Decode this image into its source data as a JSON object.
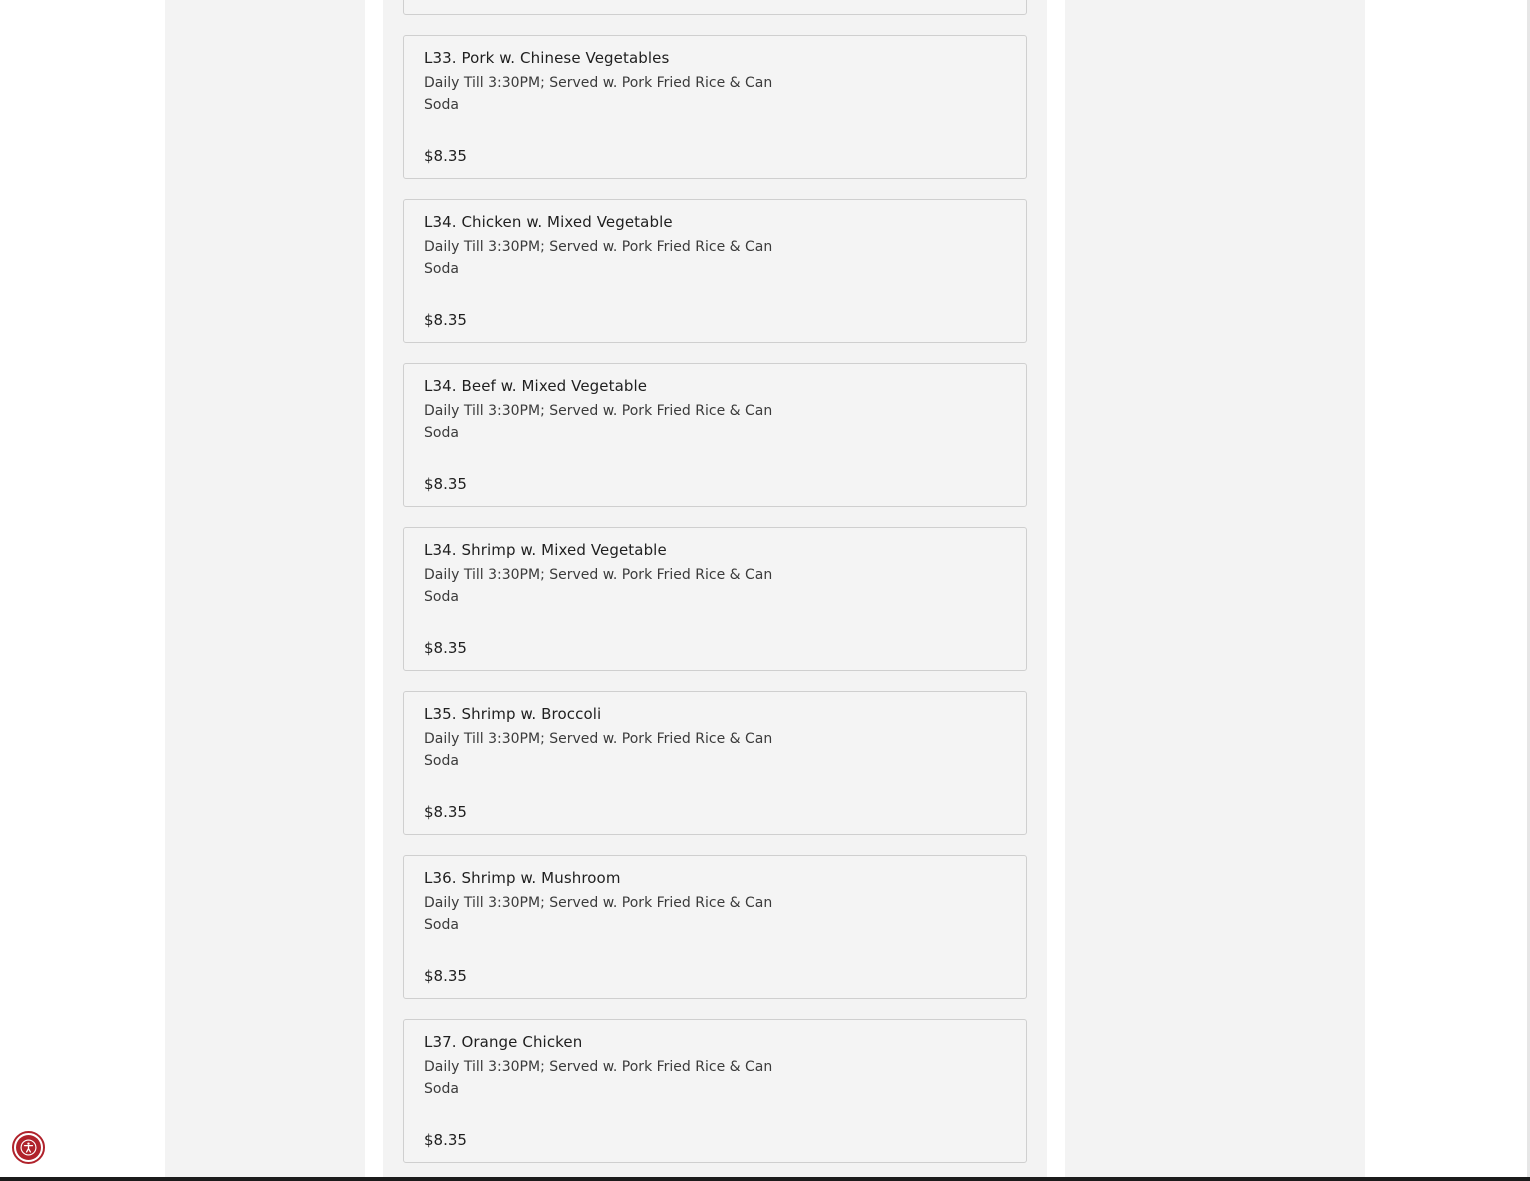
{
  "menu": {
    "items": [
      {
        "name": "L33. Pork w. Chinese Vegetables",
        "description": "Daily Till 3:30PM; Served w. Pork Fried Rice & Can Soda",
        "price": "$8.35"
      },
      {
        "name": "L34. Chicken w. Mixed Vegetable",
        "description": "Daily Till 3:30PM; Served w. Pork Fried Rice & Can Soda",
        "price": "$8.35"
      },
      {
        "name": "L34. Beef w. Mixed Vegetable",
        "description": "Daily Till 3:30PM; Served w. Pork Fried Rice & Can Soda",
        "price": "$8.35"
      },
      {
        "name": "L34. Shrimp w. Mixed Vegetable",
        "description": "Daily Till 3:30PM; Served w. Pork Fried Rice & Can Soda",
        "price": "$8.35"
      },
      {
        "name": "L35. Shrimp w. Broccoli",
        "description": "Daily Till 3:30PM; Served w. Pork Fried Rice & Can Soda",
        "price": "$8.35"
      },
      {
        "name": "L36. Shrimp w. Mushroom",
        "description": "Daily Till 3:30PM; Served w. Pork Fried Rice & Can Soda",
        "price": "$8.35"
      },
      {
        "name": "L37. Orange Chicken",
        "description": "Daily Till 3:30PM; Served w. Pork Fried Rice & Can Soda",
        "price": "$8.35"
      }
    ]
  },
  "accessibility": {
    "icon": "accessibility-icon",
    "color": "#b0222b"
  },
  "colors": {
    "card_background": "#f4f4f4",
    "column_background": "#f3f3f3",
    "card_border": "#cfcfcf",
    "text": "#1f1f1f"
  }
}
